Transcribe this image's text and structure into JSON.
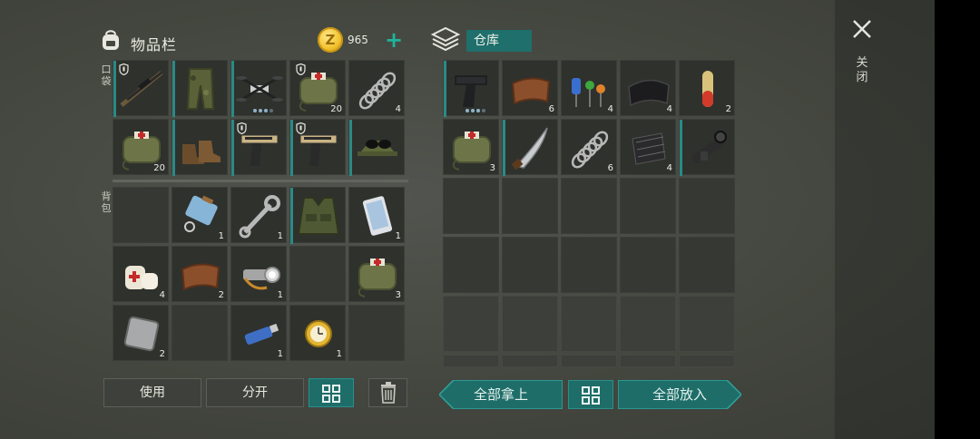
{
  "inventory": {
    "title": "物品栏",
    "pocket_label": "口袋",
    "backpack_label": "背包",
    "coins": "965",
    "coin_symbol": "Z",
    "add_icon": "plus-icon",
    "pocket_slots": [
      {
        "item": "sniper-rifle",
        "qty": "",
        "shield": true,
        "bar": true
      },
      {
        "item": "camo-pants",
        "qty": "",
        "shield": false,
        "bar": true
      },
      {
        "item": "drone",
        "qty": "",
        "shield": false,
        "bar": true,
        "dots": true
      },
      {
        "item": "medkit-bag",
        "qty": "20",
        "shield": true,
        "bar": false
      },
      {
        "item": "spring",
        "qty": "4",
        "shield": false,
        "bar": false
      },
      {
        "item": "medkit-bag",
        "qty": "20",
        "shield": false,
        "bar": false
      },
      {
        "item": "boots",
        "qty": "",
        "shield": false,
        "bar": true
      },
      {
        "item": "desert-pistol",
        "qty": "",
        "shield": true,
        "bar": true
      },
      {
        "item": "desert-pistol",
        "qty": "",
        "shield": true,
        "bar": true
      },
      {
        "item": "cap-with-goggles",
        "qty": "",
        "shield": false,
        "bar": true
      }
    ],
    "backpack_slots": [
      {
        "item": "",
        "qty": ""
      },
      {
        "item": "blue-keycard",
        "qty": "1"
      },
      {
        "item": "wrench",
        "qty": "1"
      },
      {
        "item": "tactical-vest",
        "qty": "",
        "bar": true
      },
      {
        "item": "smartphone",
        "qty": "1"
      },
      {
        "item": "bandage",
        "qty": "4"
      },
      {
        "item": "leather",
        "qty": "2"
      },
      {
        "item": "flashlight",
        "qty": "1"
      },
      {
        "item": "",
        "qty": ""
      },
      {
        "item": "medkit-bag",
        "qty": "3"
      },
      {
        "item": "metal-plate",
        "qty": "2"
      },
      {
        "item": "",
        "qty": ""
      },
      {
        "item": "usb-drive",
        "qty": "1"
      },
      {
        "item": "gold-watch",
        "qty": "1"
      },
      {
        "item": "",
        "qty": ""
      }
    ],
    "buttons": {
      "use": "使用",
      "split": "分开",
      "sort_icon": "grid-sort-icon",
      "trash_icon": "trash-icon"
    }
  },
  "warehouse": {
    "title": "仓库",
    "slots": [
      {
        "item": "pistol",
        "qty": "",
        "bar": true,
        "dots": true
      },
      {
        "item": "leather",
        "qty": "6"
      },
      {
        "item": "electronic-parts",
        "qty": "4"
      },
      {
        "item": "black-cloth",
        "qty": "4"
      },
      {
        "item": "capsule",
        "qty": "2"
      },
      {
        "item": "medkit-bag",
        "qty": "3"
      },
      {
        "item": "machete",
        "qty": "",
        "bar": true
      },
      {
        "item": "spring",
        "qty": "6"
      },
      {
        "item": "rubber-mat",
        "qty": "4"
      },
      {
        "item": "rifle-scope",
        "qty": "",
        "bar": true
      }
    ],
    "buttons": {
      "take_all": "全部拿上",
      "put_all": "全部放入",
      "sort_icon": "grid-sort-icon"
    }
  },
  "close": {
    "label": "关闭",
    "icon": "close-icon"
  },
  "colors": {
    "accent": "#1f6f6c",
    "bar": "#2a8a86",
    "coin": "#f3c22d",
    "background": "#44473f"
  }
}
